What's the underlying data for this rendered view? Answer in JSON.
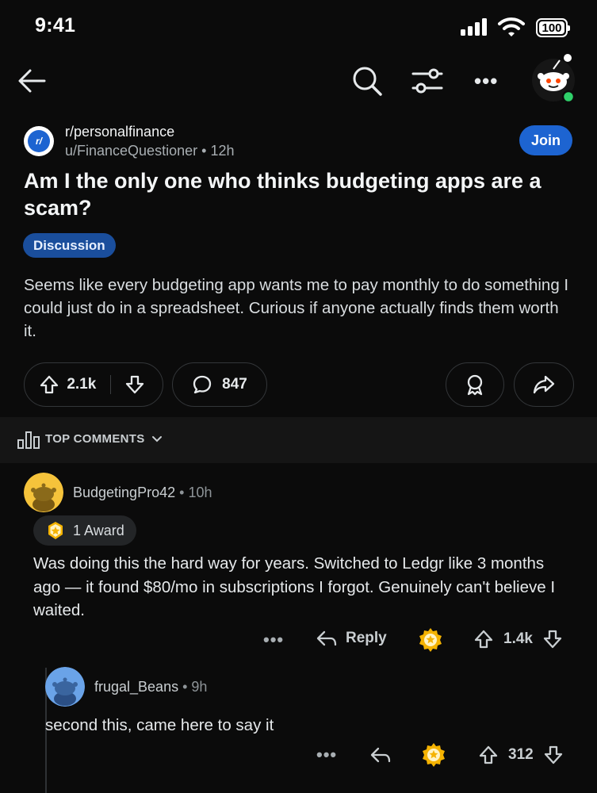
{
  "status_bar": {
    "time": "9:41",
    "battery": "100"
  },
  "post": {
    "subreddit": "r/personalfinance",
    "subreddit_icon_text": "r/",
    "author": "u/FinanceQuestioner",
    "age": "12h",
    "join_label": "Join",
    "title": "Am I the only one who thinks budgeting apps are a scam?",
    "flair": "Discussion",
    "body": "Seems like every budgeting app wants me to pay monthly to do something I could just do in a spreadsheet. Curious if anyone actually finds them worth it.",
    "upvotes": "2.1k",
    "comment_count": "847"
  },
  "sort": {
    "label": "TOP COMMENTS"
  },
  "comments": [
    {
      "username": "BudgetingPro42",
      "age": "10h",
      "award_label": "1 Award",
      "text": "Was doing this the hard way for years. Switched to Ledgr like 3 months ago — it found $80/mo in subscriptions I forgot. Genuinely can't believe I waited.",
      "reply_label": "Reply",
      "score": "1.4k",
      "avatar_color": "#f5c33b"
    },
    {
      "username": "frugal_Beans",
      "age": "9h",
      "text": "second this, came here to say it",
      "score": "312",
      "avatar_color": "#6aa3e8"
    }
  ],
  "colors": {
    "accent": "#1d64d1",
    "background": "#0b0b0b",
    "online": "#2fd06a"
  },
  "icons": [
    "back-arrow-icon",
    "search-icon",
    "filter-icon",
    "more-icon",
    "upvote-icon",
    "downvote-icon",
    "comment-icon",
    "award-icon",
    "share-icon",
    "reply-icon",
    "chevron-down-icon"
  ]
}
